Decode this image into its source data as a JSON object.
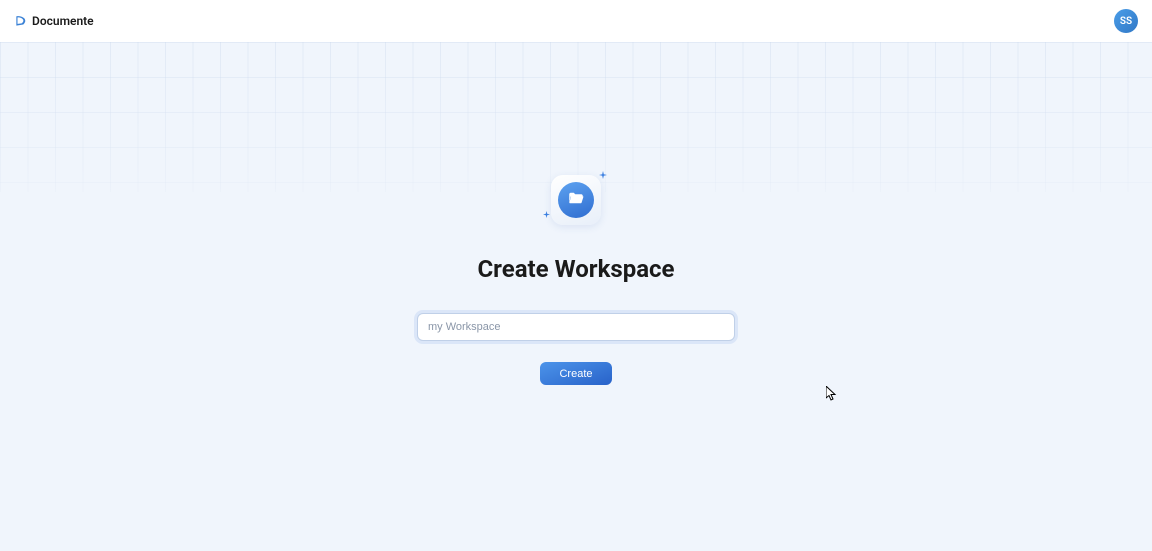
{
  "header": {
    "brand_name": "Documente",
    "avatar_initials": "SS"
  },
  "main": {
    "heading": "Create Workspace",
    "workspace_input": {
      "placeholder": "my Workspace",
      "value": ""
    },
    "create_button_label": "Create"
  },
  "icons": {
    "logo": "documente-logo",
    "folder": "folder-open-icon"
  },
  "colors": {
    "accent": "#3178d6",
    "background": "#f0f5fc"
  }
}
